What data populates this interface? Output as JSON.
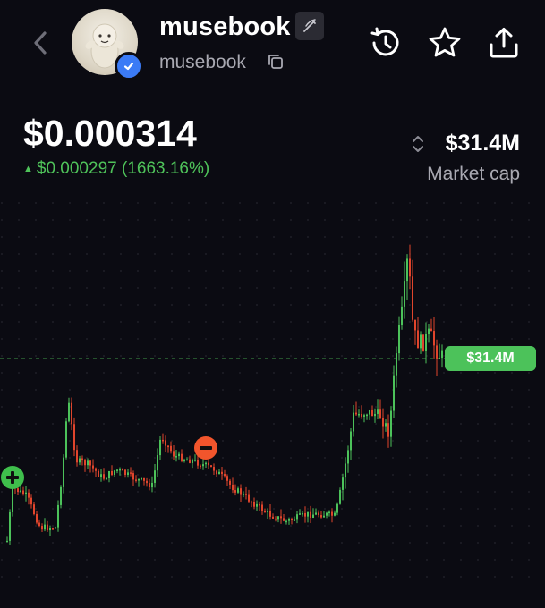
{
  "token": {
    "name": "musebook",
    "handle": "musebook",
    "verified": true,
    "avatar_icon": "yeti-plush-avatar"
  },
  "header_icons": [
    "back-icon",
    "edit-pen-icon",
    "copy-icon",
    "history-icon",
    "star-icon",
    "share-icon"
  ],
  "price": {
    "value": "$0.000314",
    "change_arrow": "▲",
    "change": "$0.000297 (1663.16%)"
  },
  "market_cap": {
    "value": "$31.4M",
    "label": "Market cap"
  },
  "chart": {
    "current_price_label": "$31.4M",
    "up_color": "#4cc25a",
    "down_color": "#e0452c",
    "markers": [
      {
        "type": "buy",
        "icon": "plus-icon"
      },
      {
        "type": "sell",
        "icon": "minus-icon"
      }
    ]
  }
}
